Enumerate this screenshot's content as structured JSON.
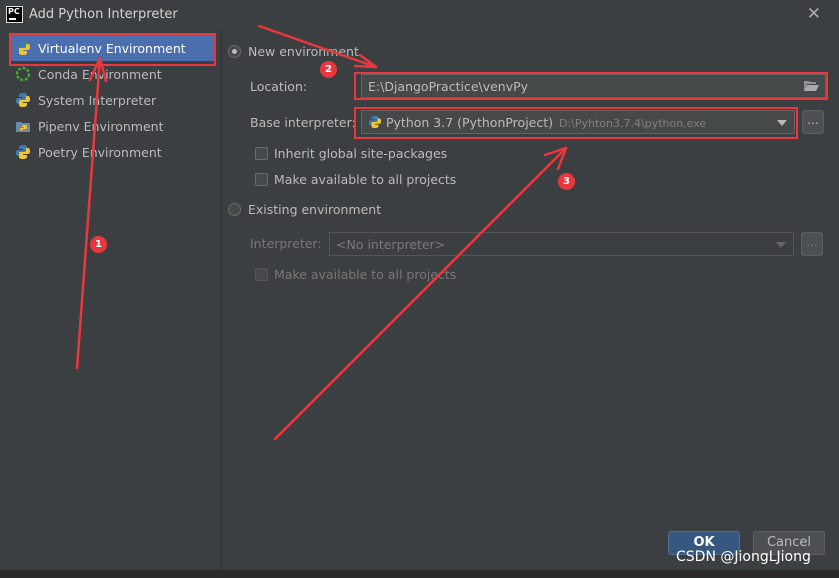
{
  "window": {
    "title": "Add Python Interpreter",
    "logo_text": "PC"
  },
  "sidebar": {
    "items": [
      {
        "label": "Virtualenv Environment",
        "selected": true,
        "icon": "python-icon"
      },
      {
        "label": "Conda Environment",
        "selected": false,
        "icon": "conda-icon"
      },
      {
        "label": "System Interpreter",
        "selected": false,
        "icon": "python-icon"
      },
      {
        "label": "Pipenv Environment",
        "selected": false,
        "icon": "pipenv-icon"
      },
      {
        "label": "Poetry Environment",
        "selected": false,
        "icon": "python-icon"
      }
    ]
  },
  "new_env": {
    "radio_label": "New environment",
    "location_label": "Location:",
    "location_value": "E:\\DjangoPractice\\venvPy",
    "base_label": "Base interpreter:",
    "base_name": "Python 3.7 (PythonProject)",
    "base_path": "D:\\Pyhton3.7.4\\python.exe",
    "inherit_label": "Inherit global site-packages",
    "make_available_label": "Make available to all projects"
  },
  "existing_env": {
    "radio_label": "Existing environment",
    "interpreter_label": "Interpreter:",
    "interpreter_placeholder": "<No interpreter>",
    "make_available_label": "Make available to all projects"
  },
  "buttons": {
    "ok": "OK",
    "cancel": "Cancel",
    "browse": "..."
  },
  "annotations": {
    "markers": [
      "1",
      "2",
      "3"
    ]
  },
  "watermark": "CSDN @JiongLJiong",
  "colors": {
    "accent_selected": "#4b6eaf",
    "annotation_red": "#e8383d",
    "ok_button": "#365880"
  }
}
